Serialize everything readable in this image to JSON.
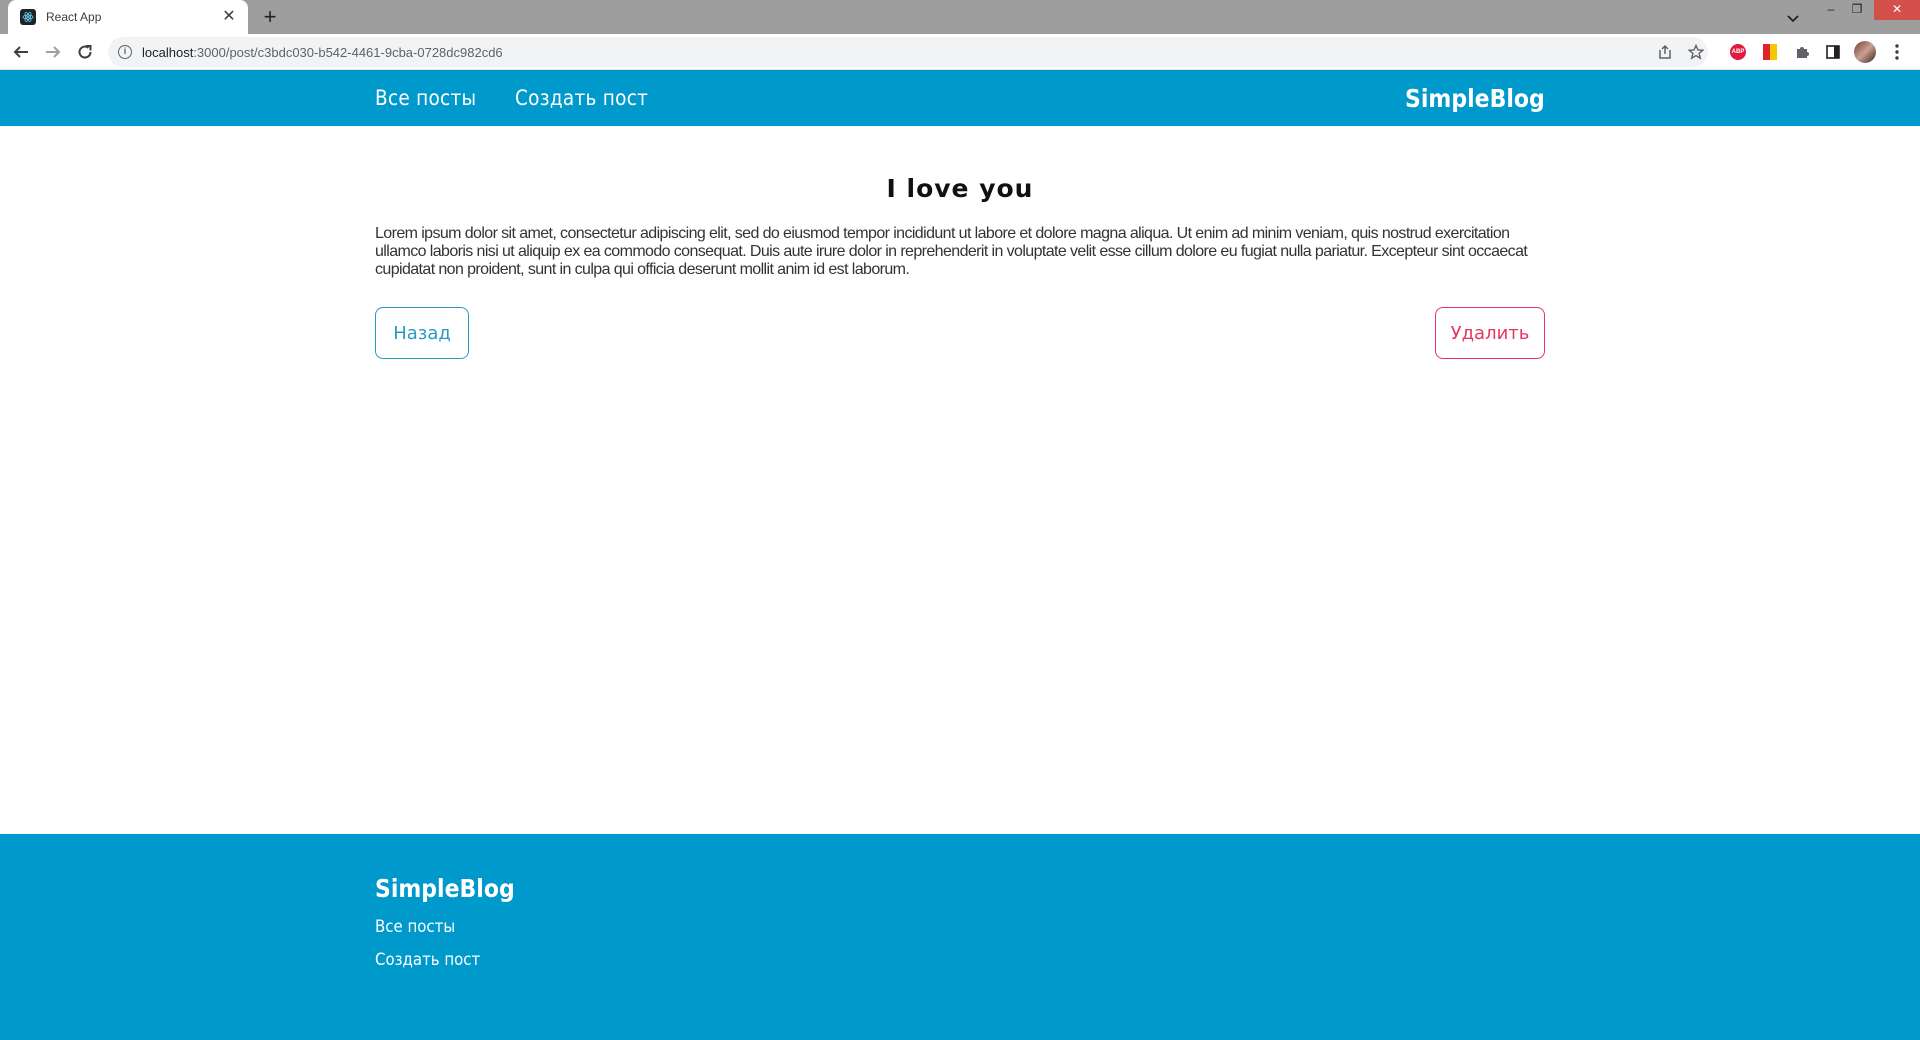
{
  "browser": {
    "tab_title": "React App",
    "tab_close": "✕",
    "new_tab": "+",
    "url_host": "localhost",
    "url_path": ":3000/post/c3bdc030-b542-4461-9cba-0728dc982cd6",
    "window_minimize": "–",
    "window_restore": "❐",
    "window_close": "✕",
    "info_symbol": "i",
    "abp_label": "ABP"
  },
  "header": {
    "nav": [
      "Все посты",
      "Создать пост"
    ],
    "brand": "SimpleBlog"
  },
  "post": {
    "title": "I love you",
    "body": "Lorem ipsum dolor sit amet, consectetur adipiscing elit, sed do eiusmod tempor incididunt ut labore et dolore magna aliqua. Ut enim ad minim veniam, quis nostrud exercitation ullamco laboris nisi ut aliquip ex ea commodo consequat. Duis aute irure dolor in reprehenderit in voluptate velit esse cillum dolore eu fugiat nulla pariatur. Excepteur sint occaecat cupidatat non proident, sunt in culpa qui officia deserunt mollit anim id est laborum.",
    "back_label": "Назад",
    "delete_label": "Удалить"
  },
  "footer": {
    "brand": "SimpleBlog",
    "links": [
      "Все посты",
      "Создать пост"
    ]
  },
  "colors": {
    "brand_blue": "#0099cc",
    "back_border": "#2b9ac4",
    "delete_border": "#e8355f"
  }
}
